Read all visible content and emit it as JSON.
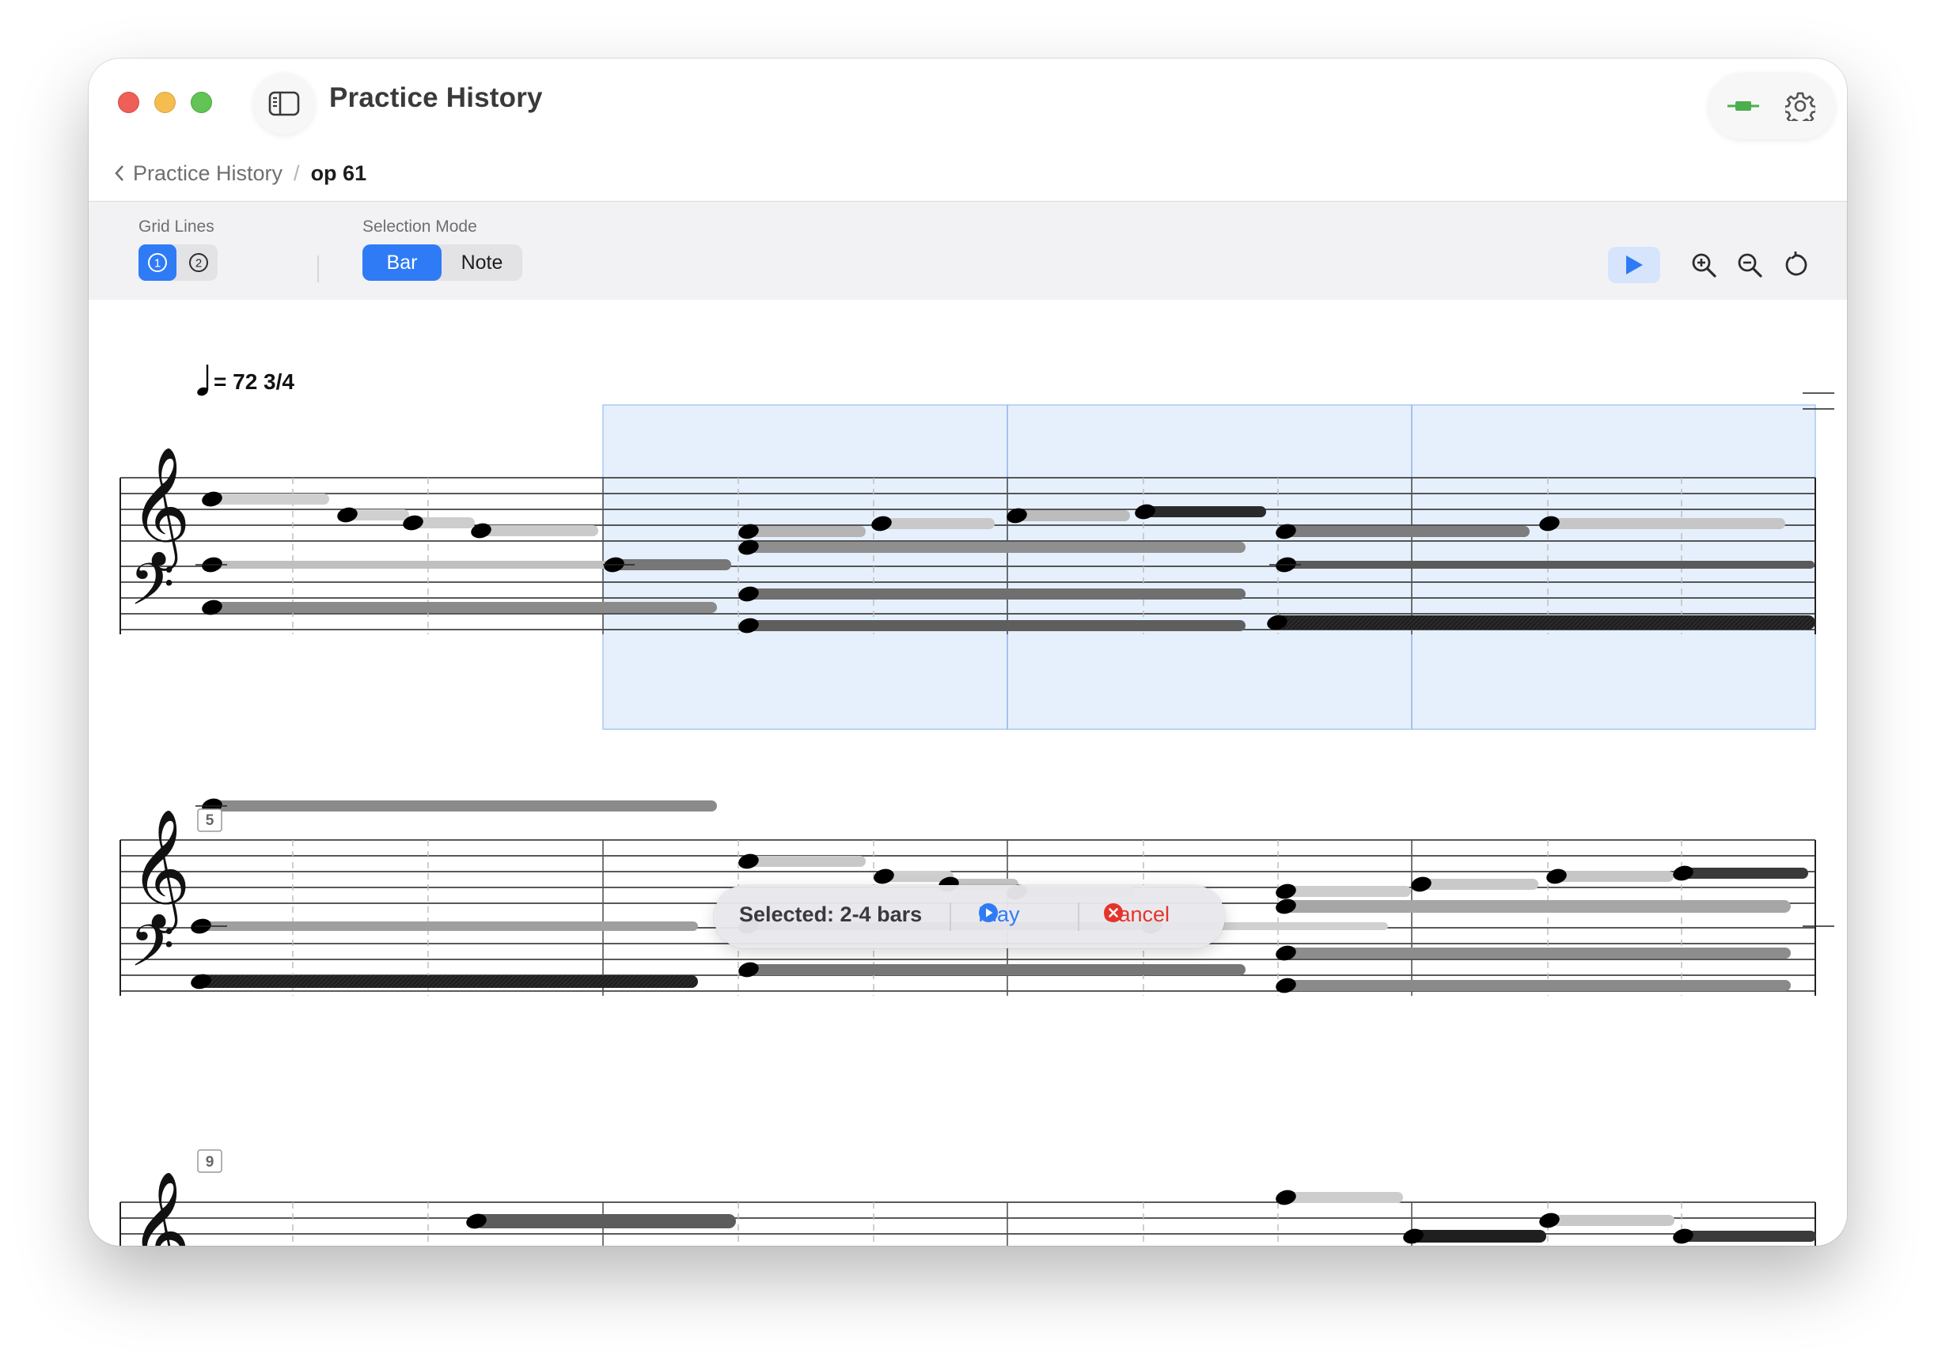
{
  "window": {
    "title": "Practice History"
  },
  "breadcrumb": {
    "back_label": "Practice History",
    "separator": "/",
    "current": "op 61"
  },
  "toolbar": {
    "grid_lines_label": "Grid Lines",
    "grid_options": [
      "1",
      "2"
    ],
    "grid_selected": "1",
    "selection_mode_label": "Selection Mode",
    "selection_modes": [
      "Bar",
      "Note"
    ],
    "selection_mode_selected": "Bar"
  },
  "score": {
    "tempo_text": "= 72 3/4",
    "measure_numbers": [
      "5",
      "9"
    ],
    "selected_range_bars": [
      2,
      4
    ],
    "highlight_color": "#e6f0fc",
    "bar_line_color": "#444444"
  },
  "actionbar": {
    "selected_text": "Selected: 2-4 bars",
    "play_label": "Play",
    "cancel_label": "Cancel"
  },
  "colors": {
    "accent": "#2f7bf6",
    "cancel": "#e5342a",
    "connected_indicator": "#4cae4c"
  },
  "icons": {
    "sidebar": "sidebar-toggle-icon",
    "connection": "plug-connected-icon",
    "settings": "gear-icon",
    "play": "play-triangle-icon",
    "zoom_in": "zoom-in-icon",
    "zoom_out": "zoom-out-icon",
    "reset": "reset-rotate-icon"
  }
}
